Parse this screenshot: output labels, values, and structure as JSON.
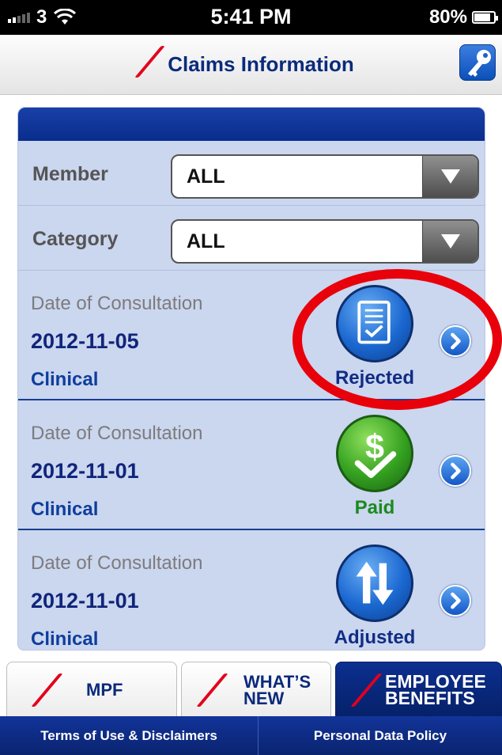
{
  "status_bar": {
    "carrier": "3",
    "time": "5:41 PM",
    "battery": "80%"
  },
  "nav": {
    "title": "Claims Information",
    "key_icon": "key-icon"
  },
  "filters": [
    {
      "label": "Member",
      "value": "ALL"
    },
    {
      "label": "Category",
      "value": "ALL"
    }
  ],
  "claims": [
    {
      "label": "Date of Consultation",
      "date": "2012-11-05",
      "type": "Clinical",
      "status": "Rejected",
      "status_icon": "document-check-icon"
    },
    {
      "label": "Date of Consultation",
      "date": "2012-11-01",
      "type": "Clinical",
      "status": "Paid",
      "status_icon": "dollar-check-icon"
    },
    {
      "label": "Date of Consultation",
      "date": "2012-11-01",
      "type": "Clinical",
      "status": "Adjusted",
      "status_icon": "up-down-arrows-icon"
    }
  ],
  "tabs": [
    {
      "line1": "MPF",
      "line2": ""
    },
    {
      "line1": "WHAT’S",
      "line2": "NEW"
    },
    {
      "line1": "EMPLOYEE",
      "line2": "BENEFITS"
    }
  ],
  "footer": {
    "terms": "Terms of Use & Disclaimers",
    "privacy": "Personal Data Policy"
  },
  "colors": {
    "brand_navy": "#0a2a7c",
    "accent_red": "#e3001b",
    "panel": "#cbd6ef",
    "paid_green": "#1b8a1f"
  }
}
